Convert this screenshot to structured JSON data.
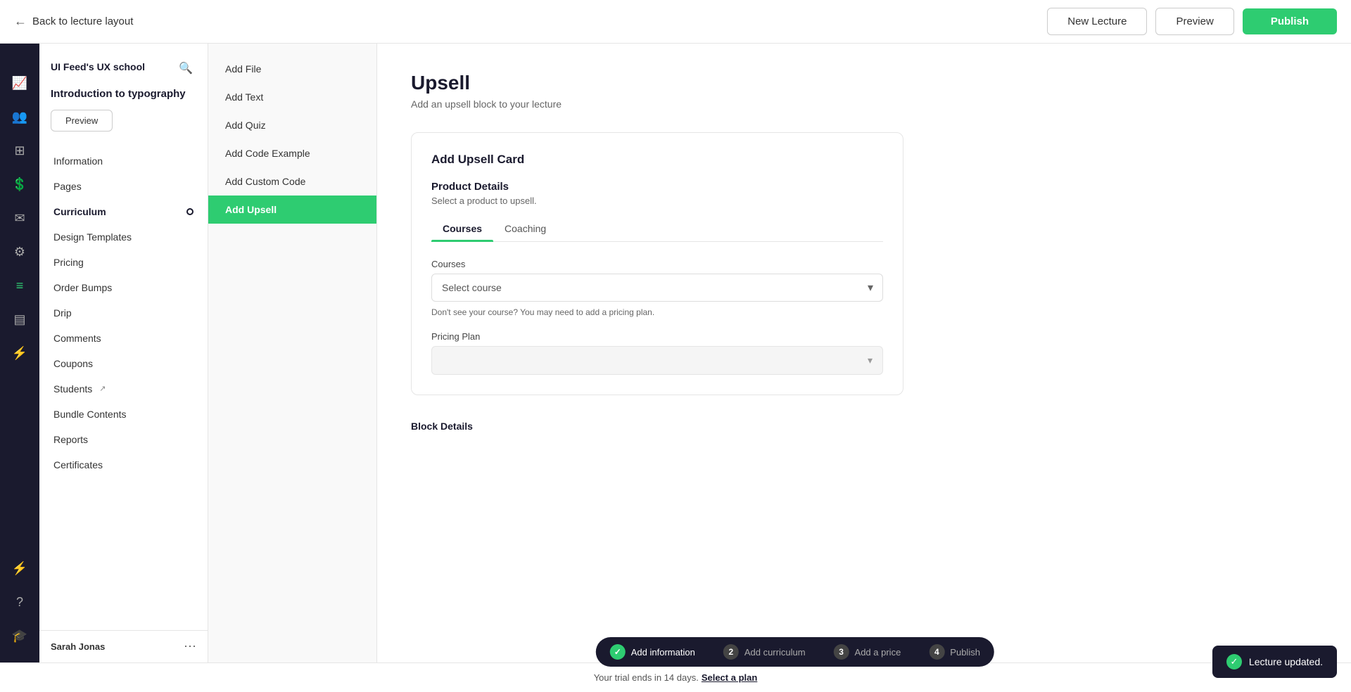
{
  "topbar": {
    "back_label": "Back to lecture layout",
    "new_lecture_label": "New Lecture",
    "preview_label": "Preview",
    "publish_label": "Publish"
  },
  "icon_sidebar": {
    "icons": [
      {
        "name": "analytics-icon",
        "symbol": "📈"
      },
      {
        "name": "users-icon",
        "symbol": "👤"
      },
      {
        "name": "dashboard-icon",
        "symbol": "▦"
      },
      {
        "name": "revenue-icon",
        "symbol": "💰"
      },
      {
        "name": "mail-icon",
        "symbol": "✉"
      },
      {
        "name": "settings-icon",
        "symbol": "⚙"
      },
      {
        "name": "library-icon",
        "symbol": "▤"
      },
      {
        "name": "calendar-icon",
        "symbol": "📅"
      },
      {
        "name": "integrations-icon",
        "symbol": "⚡"
      }
    ],
    "bottom_icons": [
      {
        "name": "lightning-icon",
        "symbol": "⚡"
      },
      {
        "name": "help-icon",
        "symbol": "?"
      },
      {
        "name": "graduation-icon",
        "symbol": "🎓"
      }
    ]
  },
  "school": {
    "name": "UI Feed's UX school"
  },
  "nav_sidebar": {
    "title": "Introduction to typography",
    "preview_label": "Preview",
    "items": [
      {
        "label": "Information",
        "key": "information",
        "active": false
      },
      {
        "label": "Pages",
        "key": "pages",
        "active": false
      },
      {
        "label": "Curriculum",
        "key": "curriculum",
        "active": true,
        "has_dot": true
      },
      {
        "label": "Design Templates",
        "key": "design-templates",
        "active": false
      },
      {
        "label": "Pricing",
        "key": "pricing",
        "active": false
      },
      {
        "label": "Order Bumps",
        "key": "order-bumps",
        "active": false
      },
      {
        "label": "Drip",
        "key": "drip",
        "active": false
      },
      {
        "label": "Comments",
        "key": "comments",
        "active": false
      },
      {
        "label": "Coupons",
        "key": "coupons",
        "active": false
      },
      {
        "label": "Students",
        "key": "students",
        "active": false,
        "external": true
      },
      {
        "label": "Bundle Contents",
        "key": "bundle-contents",
        "active": false
      },
      {
        "label": "Reports",
        "key": "reports",
        "active": false
      },
      {
        "label": "Certificates",
        "key": "certificates",
        "active": false
      }
    ],
    "user_name": "Sarah Jonas"
  },
  "content_sidebar": {
    "items": [
      {
        "label": "Add File",
        "key": "add-file",
        "active": false
      },
      {
        "label": "Add Text",
        "key": "add-text",
        "active": false
      },
      {
        "label": "Add Quiz",
        "key": "add-quiz",
        "active": false
      },
      {
        "label": "Add Code Example",
        "key": "add-code-example",
        "active": false
      },
      {
        "label": "Add Custom Code",
        "key": "add-custom-code",
        "active": false
      },
      {
        "label": "Add Upsell",
        "key": "add-upsell",
        "active": true
      }
    ]
  },
  "main": {
    "title": "Upsell",
    "subtitle": "Add an upsell block to your lecture",
    "card": {
      "title": "Add Upsell Card",
      "section_title": "Product Details",
      "section_subtitle": "Select a product to upsell.",
      "tabs": [
        {
          "label": "Courses",
          "active": true
        },
        {
          "label": "Coaching",
          "active": false
        }
      ],
      "courses_label": "Courses",
      "select_placeholder": "Select course",
      "helper_text": "Don't see your course? You may need to add a pricing plan.",
      "pricing_plan_label": "Pricing Plan"
    },
    "block_details_title": "Block Details"
  },
  "progress": {
    "steps": [
      {
        "num": "✓",
        "label": "Add information",
        "done": true
      },
      {
        "num": "2",
        "label": "Add curriculum",
        "done": false
      },
      {
        "num": "3",
        "label": "Add a price",
        "done": false
      },
      {
        "num": "4",
        "label": "Publish",
        "done": false
      }
    ]
  },
  "bottom_bar": {
    "text": "Your trial ends in 14 days.",
    "link_label": "Select a plan"
  },
  "bottom_button": {
    "label": "Publish"
  },
  "toast": {
    "message": "Lecture updated."
  }
}
